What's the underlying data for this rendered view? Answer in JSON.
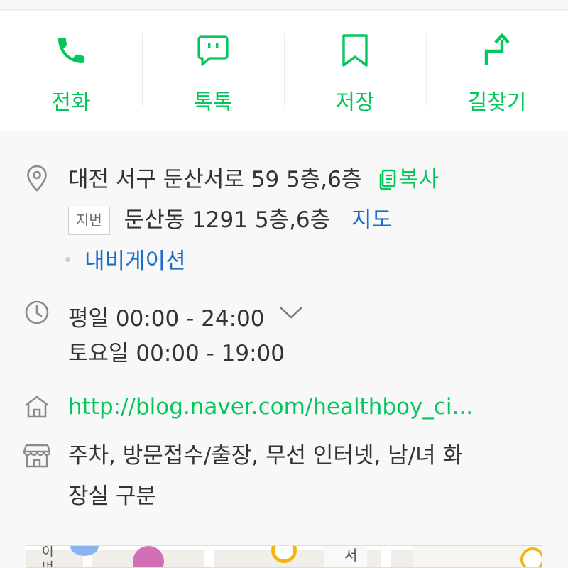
{
  "actions": [
    {
      "label": "전화",
      "icon": "phone-icon"
    },
    {
      "label": "톡톡",
      "icon": "chat-icon"
    },
    {
      "label": "저장",
      "icon": "bookmark-icon"
    },
    {
      "label": "길찾기",
      "icon": "directions-icon"
    }
  ],
  "address": {
    "road": "대전 서구 둔산서로 59 5층,6층",
    "copy_label": "복사",
    "jibeon_tag": "지번",
    "jibeon": "둔산동 1291 5층,6층",
    "map_label": "지도",
    "navigation_label": "내비게이션"
  },
  "hours": {
    "weekday": "평일 00:00 - 24:00",
    "saturday": "토요일 00:00 - 19:00"
  },
  "homepage": {
    "url": "http://blog.naver.com/healthboy_ci..."
  },
  "amenities": {
    "line1": "주차, 방문접수/출장, 무선 인터넷, 남/녀 화",
    "line2": "장실 구분"
  },
  "map_preview": {
    "label_left": "이번",
    "label_mid": "서"
  },
  "colors": {
    "accent": "#03c75a",
    "link": "#1a6dd0"
  }
}
